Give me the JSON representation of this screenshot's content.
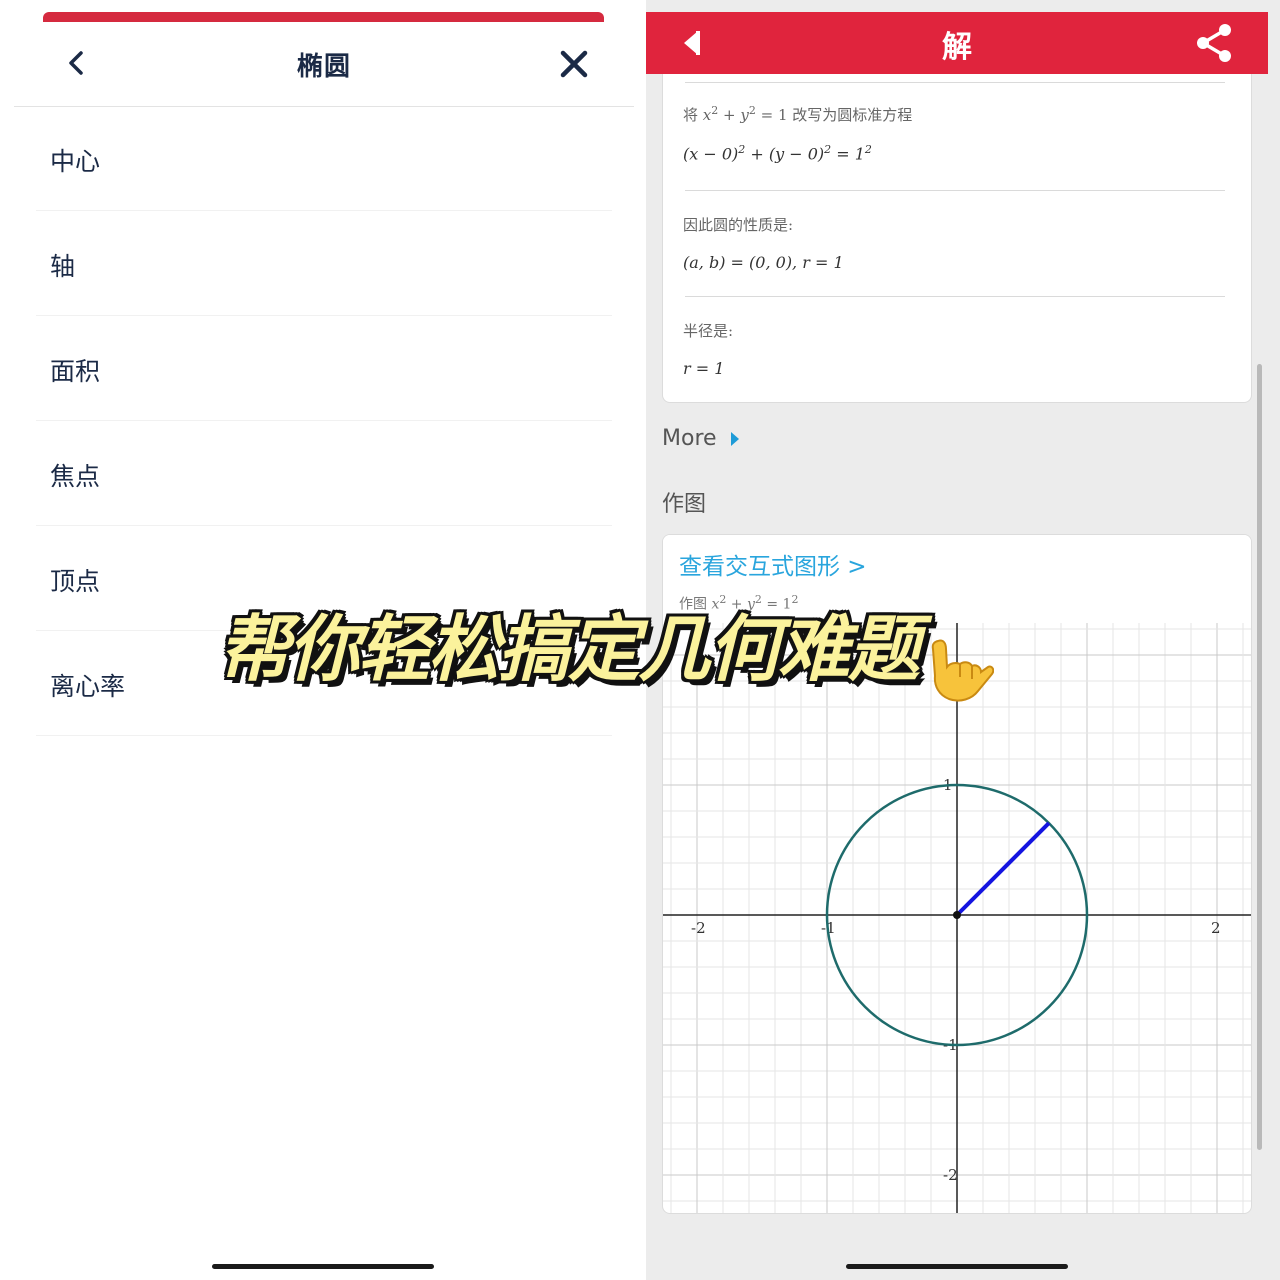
{
  "left": {
    "title": "椭圆",
    "menu": [
      {
        "label": "中心"
      },
      {
        "label": "轴"
      },
      {
        "label": "面积"
      },
      {
        "label": "焦点"
      },
      {
        "label": "顶点"
      },
      {
        "label": "离心率"
      }
    ]
  },
  "right": {
    "title": "解",
    "steps": [
      {
        "text": "改写为圆标准方程",
        "eq": ""
      },
      {
        "text": "因此圆的性质是:",
        "eq": ""
      },
      {
        "text": "半径是:",
        "eq": "r = 1"
      }
    ],
    "more_label": "More",
    "graph_section_label": "作图",
    "interactive_link": "查看交互式图形 >",
    "plot_caption": "作图"
  },
  "overlay": {
    "caption": "帮你轻松搞定几何难题",
    "emoji_icon": "call-me-hand-icon"
  },
  "colors": {
    "header_red": "#e0243d",
    "link_blue": "#29a5dd",
    "circle": "#1e6b6b",
    "radius": "#1414e0"
  },
  "chart_data": {
    "type": "line",
    "title": "",
    "xlabel": "",
    "ylabel": "",
    "xlim": [
      -2.25,
      2.25
    ],
    "ylim": [
      -2.25,
      2.25
    ],
    "x_ticks": [
      -2,
      -1,
      2
    ],
    "y_ticks": [
      1,
      -1,
      -2
    ],
    "grid": true,
    "series": [
      {
        "kind": "circle",
        "center": [
          0,
          0
        ],
        "radius": 1
      },
      {
        "kind": "segment",
        "points": [
          [
            0,
            0
          ],
          [
            0.707,
            0.707
          ]
        ]
      },
      {
        "kind": "point",
        "points": [
          [
            0,
            0
          ]
        ]
      }
    ]
  }
}
